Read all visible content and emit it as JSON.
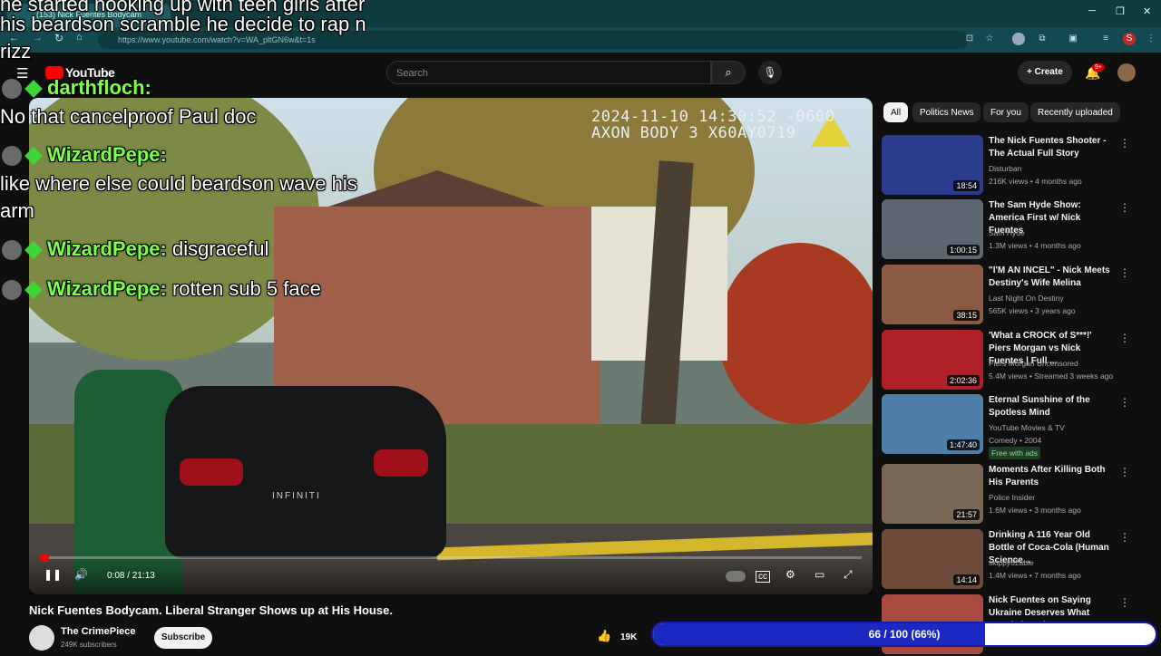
{
  "browser": {
    "tab_title": "(153) Nick Fuentes Bodycam",
    "url": "https://www.youtube.com/watch?v=WA_pltGN6w&t=1s"
  },
  "youtube": {
    "logo_text": "YouTube",
    "search_placeholder": "Search",
    "create_label": "Create",
    "notif_count": "9+"
  },
  "overlay": {
    "top_caption_1": "he started hooking up with teen girls after",
    "top_caption_2": "his beardson scramble he decide to rap n",
    "top_caption_3": "rizz",
    "messages": [
      {
        "user": "darthfloch:",
        "text": ""
      },
      {
        "user": "",
        "text": "No that cancelproof Paul doc"
      },
      {
        "user": "WizardPepe:",
        "text": ""
      },
      {
        "user": "",
        "text": "like where else could beardson wave his"
      },
      {
        "user": "",
        "text": "arm"
      },
      {
        "user": "WizardPepe:",
        "text": "disgraceful"
      },
      {
        "user": "WizardPepe:",
        "text": "rotten sub 5 face"
      }
    ]
  },
  "player": {
    "timestamp_line1": "2024-11-10 14:30:52 -0600",
    "timestamp_line2": "AXON BODY 3 X60AY0719",
    "car_badge": "INFINITI",
    "time": "0:08 / 21:13",
    "progress": 0.006
  },
  "video": {
    "title": "Nick Fuentes Bodycam. Liberal Stranger Shows up at His House.",
    "channel": "The CrimePiece",
    "subscribers": "249K subscribers",
    "subscribe_label": "Subscribe",
    "likes": "19K"
  },
  "chips": [
    "All",
    "Politics News",
    "For you",
    "Recently uploaded"
  ],
  "recommendations": [
    {
      "title": "The Nick Fuentes Shooter - The Actual Full Story",
      "channel": "Disturban",
      "meta": "216K views • 4 months ago",
      "duration": "18:54",
      "extra": "",
      "color": "#2b3c8c"
    },
    {
      "title": "The Sam Hyde Show: America First w/ Nick Fuentes",
      "channel": "Sam Hyde",
      "meta": "1.3M views • 4 months ago",
      "duration": "1:00:15",
      "extra": "",
      "color": "#5c6670"
    },
    {
      "title": "\"I'M AN INCEL\" - Nick Meets Destiny's Wife Melina",
      "channel": "Last Night On Destiny",
      "meta": "565K views • 3 years ago",
      "duration": "38:15",
      "extra": "",
      "color": "#8a5a42"
    },
    {
      "title": "'What a CROCK of S***!' Piers Morgan vs Nick Fuentes | Full ...",
      "channel": "Piers Morgan Uncensored",
      "meta": "5.4M views • Streamed 3 weeks ago",
      "duration": "2:02:36",
      "extra": "",
      "color": "#b02028"
    },
    {
      "title": "Eternal Sunshine of the Spotless Mind",
      "channel": "YouTube Movies & TV",
      "meta": "Comedy • 2004",
      "duration": "1:47:40",
      "extra": "Free with ads",
      "color": "#4d7fa8"
    },
    {
      "title": "Moments After Killing Both His Parents",
      "channel": "Police Insider",
      "meta": "1.6M views • 3 months ago",
      "duration": "21:57",
      "extra": "",
      "color": "#7a6654"
    },
    {
      "title": "Drinking A 116 Year Old Bottle of Coca-Cola (Human Science...",
      "channel": "skippy62able",
      "meta": "1.4M views • 7 months ago",
      "duration": "14:14",
      "extra": "",
      "color": "#6e4a3a"
    },
    {
      "title": "Nick Fuentes on Saying Ukraine Deserves What Russia is Doing",
      "channel": "",
      "meta": "",
      "duration": "",
      "extra": "",
      "color": "#a84a3e"
    }
  ],
  "task_progress": {
    "label": "66 / 100 (66%)",
    "fraction": 0.66
  }
}
